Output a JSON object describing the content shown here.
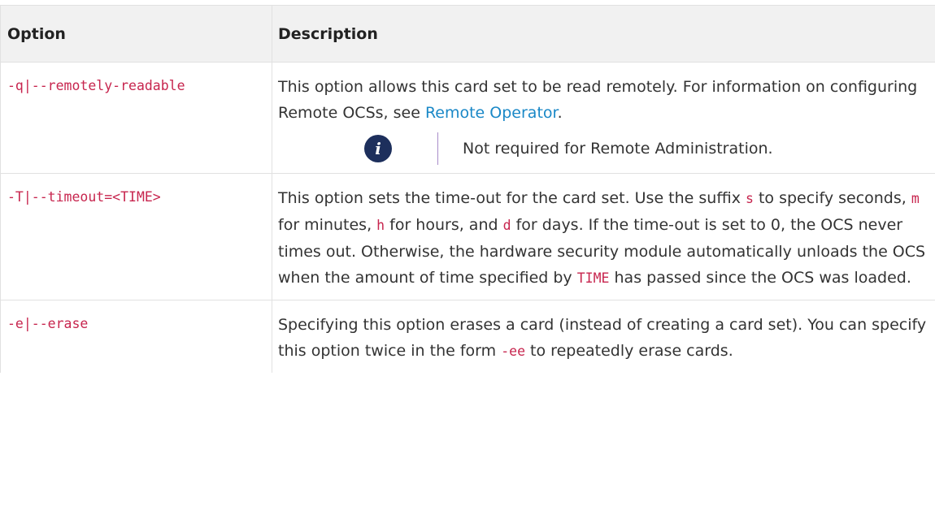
{
  "table": {
    "headers": {
      "option": "Option",
      "description": "Description"
    },
    "rows": [
      {
        "option": "-q|--remotely-readable",
        "desc_before_link": "This option allows this card set to be read remotely. For information on configuring Remote OCSs, see ",
        "link": "Remote Operator",
        "desc_after_link": ".",
        "note": "Not required for Remote Administration.",
        "note_icon": "info-icon"
      },
      {
        "option": "-T|--timeout=<TIME>",
        "parts": [
          "This option sets the time-out for the card set. Use the suffix ",
          "s",
          " to specify seconds, ",
          "m",
          " for minutes, ",
          "h",
          " for hours, and ",
          "d",
          " for days. If the time-out is set to 0, the OCS never times out. Otherwise, the hardware security module automatically unloads the OCS when the amount of time specified by ",
          "TIME",
          " has passed since the OCS was loaded."
        ]
      },
      {
        "option": "-e|--erase",
        "parts": [
          "Specifying this option erases a card (instead of creating a card set). You can specify this option twice in the form ",
          "-ee",
          " to repeatedly erase cards."
        ]
      }
    ]
  },
  "colors": {
    "code": "#c7254e",
    "link": "#1a88c7",
    "header_bg": "#f1f1f1",
    "info_icon_bg": "#1d2f5c",
    "note_rule": "#a98cc9"
  }
}
